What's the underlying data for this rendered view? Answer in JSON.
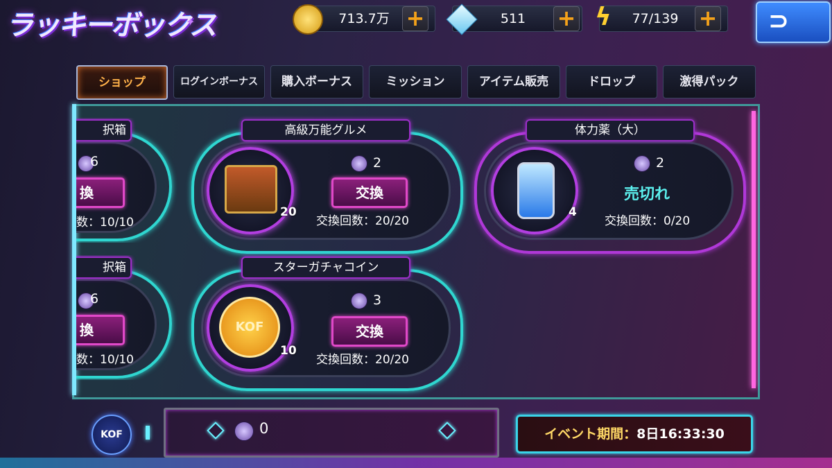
{
  "header": {
    "title": "ラッキーボックス",
    "resources": [
      {
        "icon": "gold-coin-icon",
        "value": "713.7万"
      },
      {
        "icon": "diamond-icon",
        "value": "511"
      },
      {
        "icon": "lightning-icon",
        "value": "77/139"
      }
    ],
    "plus_label": "+",
    "back_icon": "back-arrow-icon"
  },
  "tabs": [
    {
      "label": "ショップ",
      "active": true
    },
    {
      "label": "ログインボーナス",
      "active": false
    },
    {
      "label": "購入ボーナス",
      "active": false
    },
    {
      "label": "ミッション",
      "active": false
    },
    {
      "label": "アイテム販売",
      "active": false
    },
    {
      "label": "ドロップ",
      "active": false
    },
    {
      "label": "激得パック",
      "active": false
    }
  ],
  "items": [
    {
      "name": "択箱",
      "cost": "6",
      "action": "換",
      "count": "数：10/10"
    },
    {
      "name": "高級万能グルメ",
      "qty": "20",
      "cost": "2",
      "action": "交換",
      "count": "交換回数：20/20"
    },
    {
      "name": "体力薬（大）",
      "qty": "4",
      "cost": "2",
      "status": "売切れ",
      "count": "交換回数：0/20"
    },
    {
      "name": "択箱",
      "cost": "6",
      "action": "換",
      "count": "数：10/10"
    },
    {
      "name": "スターガチャコイン",
      "qty": "10",
      "cost": "3",
      "action": "交換",
      "count": "交換回数：20/20",
      "coin_text": "KOF"
    }
  ],
  "footer": {
    "kof_label": "KOF",
    "balance": "0",
    "event_label": "イベント期間：",
    "event_time": "8日16:33:30"
  },
  "colors": {
    "accent_cyan": "#2fd6d0",
    "accent_pink": "#e048c8",
    "gold": "#f4a21a"
  }
}
